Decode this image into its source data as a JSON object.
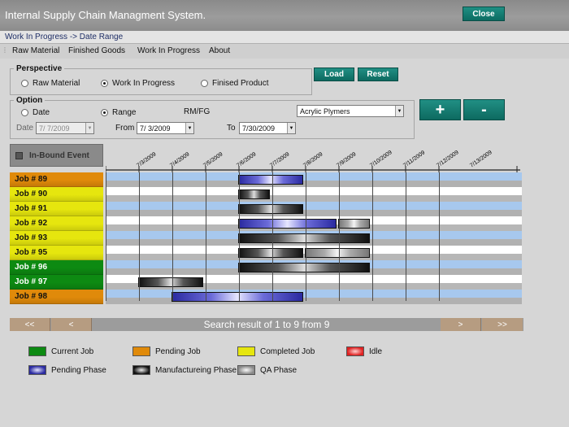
{
  "window": {
    "title": "Internal Supply Chain Managment System.",
    "close_label": "Close"
  },
  "breadcrumb": "Work In Progress -> Date Range",
  "menu": [
    "Raw Material",
    "Finished Goods",
    "Work In Progress",
    "About"
  ],
  "perspective": {
    "legend": "Perspective",
    "options": [
      "Raw Material",
      "Work In Progress",
      "Finised Product"
    ],
    "selected": "Work In Progress",
    "load_label": "Load",
    "reset_label": "Reset"
  },
  "option": {
    "legend": "Option",
    "radio_date": "Date",
    "radio_range": "Range",
    "selected": "Range",
    "rmfg_label": "RM/FG",
    "product_select": "Acrylic Plymers",
    "date_label": "Date",
    "date_value": "7/ 7/2009",
    "from_label": "From",
    "from_value": "7/ 3/2009",
    "to_label": "To",
    "to_value": "7/30/2009",
    "zoom_in_label": "+",
    "zoom_out_label": "-"
  },
  "inbound_label": "In-Bound Event",
  "dates": [
    "7/3/2009",
    "7/4/2009",
    "7/5/2009",
    "7/6/2009",
    "7/7/2009",
    "7/8/2009",
    "7/9/2009",
    "7/10/2009",
    "7/11/2009",
    "7/12/2009",
    "7/13/2009"
  ],
  "colors": {
    "current": "#0d8a12",
    "pending": "#e08a0a",
    "completed": "#e6e60e",
    "idle": "#e02020"
  },
  "jobs": [
    {
      "label": "Job # 89",
      "status": "pending",
      "phases": [
        {
          "type": "pending",
          "start": "7/7/2009",
          "end": "7/9/2009"
        }
      ]
    },
    {
      "label": "Job # 90",
      "status": "completed",
      "phases": [
        {
          "type": "mfg",
          "start": "7/7/2009",
          "end": "7/8/2009"
        }
      ]
    },
    {
      "label": "Job # 91",
      "status": "completed",
      "phases": [
        {
          "type": "mfg",
          "start": "7/7/2009",
          "end": "7/9/2009"
        }
      ]
    },
    {
      "label": "Job # 92",
      "status": "completed",
      "phases": [
        {
          "type": "pending",
          "start": "7/7/2009",
          "end": "7/10/2009"
        },
        {
          "type": "qa",
          "start": "7/10/2009",
          "end": "7/11/2009"
        }
      ]
    },
    {
      "label": "Job # 93",
      "status": "completed",
      "phases": [
        {
          "type": "mfg",
          "start": "7/7/2009",
          "end": "7/11/2009"
        }
      ]
    },
    {
      "label": "Job # 95",
      "status": "completed",
      "phases": [
        {
          "type": "mfg",
          "start": "7/7/2009",
          "end": "7/9/2009"
        },
        {
          "type": "qa",
          "start": "7/9/2009",
          "end": "7/11/2009"
        }
      ]
    },
    {
      "label": "Job # 96",
      "status": "current",
      "phases": [
        {
          "type": "mfg",
          "start": "7/7/2009",
          "end": "7/11/2009"
        }
      ]
    },
    {
      "label": "Job # 97",
      "status": "current",
      "phases": [
        {
          "type": "mfg",
          "start": "7/4/2009",
          "end": "7/6/2009"
        }
      ]
    },
    {
      "label": "Job # 98",
      "status": "pending",
      "phases": [
        {
          "type": "pending",
          "start": "7/5/2009",
          "end": "7/9/2009"
        }
      ]
    }
  ],
  "pager": {
    "first": "<<",
    "prev": "<",
    "result": "Search result of 1 to 9 from 9",
    "next": ">",
    "last": ">>"
  },
  "legend": {
    "current_job": "Current Job",
    "pending_job": "Pending Job",
    "completed_job": "Completed Job",
    "idle": "Idle",
    "pending_phase": "Pending Phase",
    "mfg_phase": "Manufactureing Phase",
    "qa_phase": "QA Phase"
  }
}
